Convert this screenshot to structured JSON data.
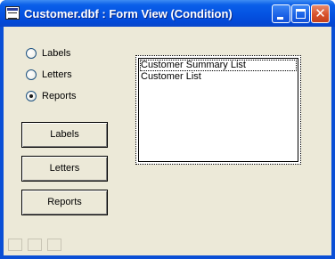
{
  "window": {
    "title": "Customer.dbf : Form View (Condition)",
    "close_glyph": "✕"
  },
  "options": [
    {
      "label": "Labels",
      "checked": false
    },
    {
      "label": "Letters",
      "checked": false
    },
    {
      "label": "Reports",
      "checked": true
    }
  ],
  "buttons": {
    "labels": "Labels",
    "letters": "Letters",
    "reports": "Reports"
  },
  "list": {
    "items": [
      "Customer Summary List",
      "Customer List"
    ]
  },
  "colors": {
    "titlebar": "#0554e3",
    "client": "#ece9d8",
    "close": "#d8522c"
  }
}
